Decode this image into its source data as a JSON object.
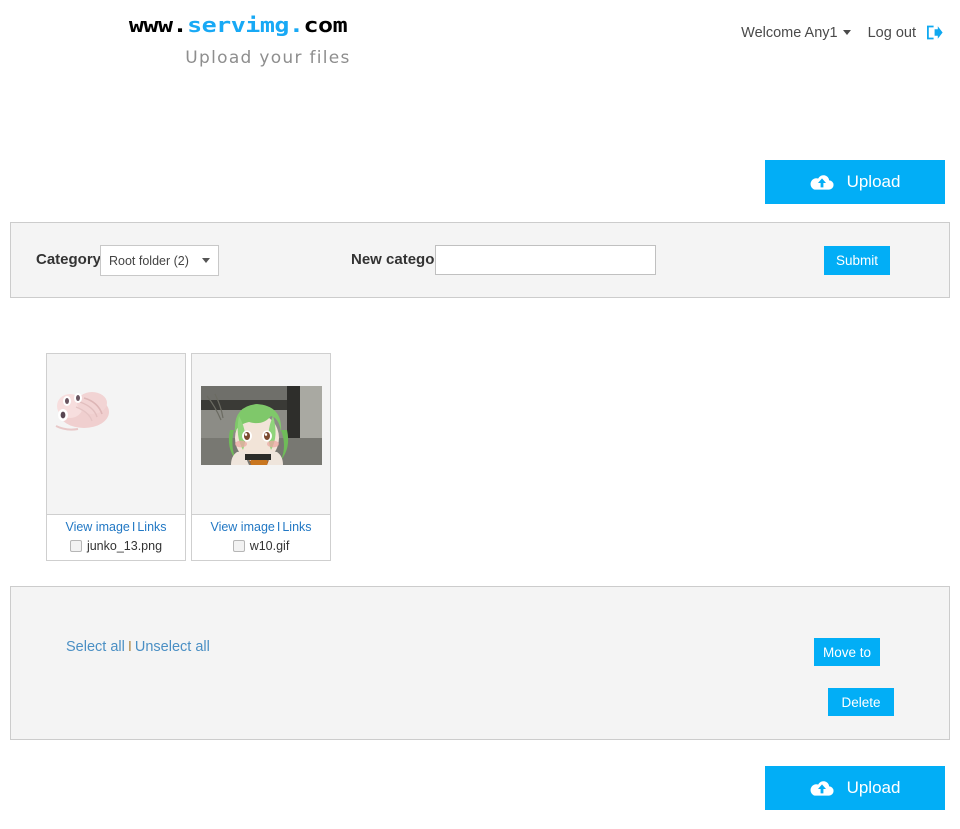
{
  "header": {
    "logo": {
      "part_www": "www.",
      "part_brand": "servimg",
      "part_dot": ".",
      "part_com": "com",
      "tagline": "Upload your files"
    },
    "welcome_label": "Welcome Any1",
    "logout_label": "Log out",
    "logout_icon": "sign-out-icon",
    "caret_icon": "caret-down-icon"
  },
  "upload_top": {
    "label": "Upload",
    "icon": "cloud-upload-icon"
  },
  "upload_bottom": {
    "label": "Upload",
    "icon": "cloud-upload-icon"
  },
  "category_panel": {
    "category_label": "Category",
    "category_selected": "Root folder (2)",
    "category_options": [
      "Root folder (2)"
    ],
    "new_category_label": "New category",
    "new_category_value": "",
    "new_category_placeholder": "",
    "submit_label": "Submit"
  },
  "gallery": {
    "view_image_label": "View image",
    "links_label": "Links",
    "separator": "I",
    "items": [
      {
        "filename": "junko_13.png",
        "checked": false,
        "thumb_alt": "pale pink character thumbnail"
      },
      {
        "filename": "w10.gif",
        "checked": false,
        "thumb_alt": "green haired anime character thumbnail"
      }
    ]
  },
  "actions_panel": {
    "select_all_label": "Select all",
    "unselect_all_label": "Unselect all",
    "separator": "I",
    "move_to_label": "Move to",
    "delete_label": "Delete"
  },
  "colors": {
    "accent_blue": "#02AEF6",
    "logo_blue": "#18A9F5",
    "link_blue": "#2278c4",
    "muted_link": "#4a8fc4",
    "panel_bg": "#f4f4f4",
    "panel_border": "#cccccc"
  }
}
